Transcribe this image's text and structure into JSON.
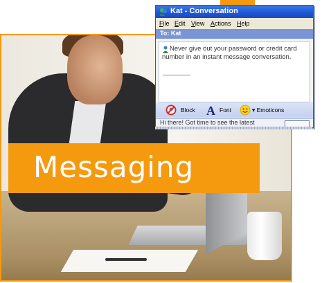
{
  "banner": {
    "label": "Messaging"
  },
  "conversation_window": {
    "title": "Kat - Conversation",
    "menu": [
      {
        "label": "File",
        "key": "F",
        "rest": "ile"
      },
      {
        "label": "Edit",
        "key": "E",
        "rest": "dit"
      },
      {
        "label": "View",
        "key": "V",
        "rest": "iew"
      },
      {
        "label": "Actions",
        "key": "A",
        "rest": "ctions"
      },
      {
        "label": "Help",
        "key": "H",
        "rest": "elp"
      }
    ],
    "to_line": "To:  Kat",
    "warning_message": "Never give out your password or credit card number in an instant message conversation.",
    "toolbar": {
      "block_label": "Block",
      "font_label": "Font",
      "emoticons_label": "▾ Emoticons"
    },
    "input_preview": "Hi there! Got time to see the latest"
  },
  "colors": {
    "accent_orange": "#f59a0f",
    "title_bar_blue": "#1f56d4",
    "to_bar_blue": "#7a95d6"
  },
  "icons": [
    "messenger-icon",
    "buddy-icon",
    "block-icon",
    "font-icon",
    "emoticon-icon"
  ]
}
